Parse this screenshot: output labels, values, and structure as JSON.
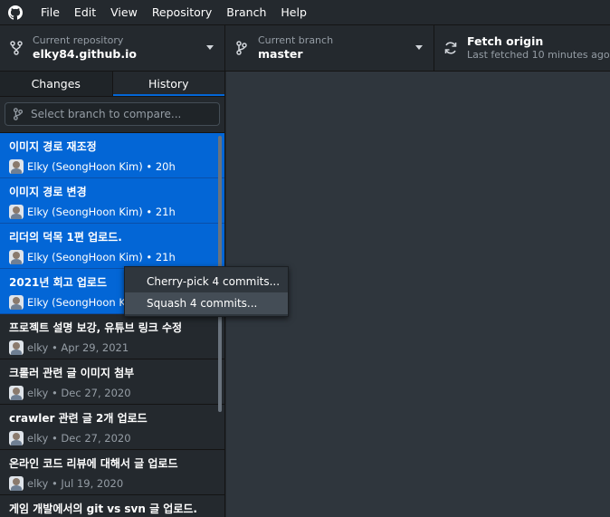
{
  "menubar": {
    "items": [
      "File",
      "Edit",
      "View",
      "Repository",
      "Branch",
      "Help"
    ]
  },
  "toolbar": {
    "repo_label": "Current repository",
    "repo_value": "elky84.github.io",
    "branch_label": "Current branch",
    "branch_value": "master",
    "fetch_title": "Fetch origin",
    "fetch_sub": "Last fetched 10 minutes ago"
  },
  "tabs": {
    "changes": "Changes",
    "history": "History"
  },
  "compare": {
    "placeholder": "Select branch to compare..."
  },
  "commits": [
    {
      "title": "이미지 경로 재조정",
      "meta": "Elky (SeongHoon Kim) • 20h",
      "selected": true
    },
    {
      "title": "이미지 경로 변경",
      "meta": "Elky (SeongHoon Kim) • 21h",
      "selected": true
    },
    {
      "title": "리더의 덕목 1편 업로드.",
      "meta": "Elky (SeongHoon Kim) • 21h",
      "selected": true
    },
    {
      "title": "2021년 회고 업로드",
      "meta": "Elky (SeongHoon Kim",
      "selected": true
    },
    {
      "title": "프로젝트 설명 보강, 유튜브 링크 수정",
      "meta": "elky • Apr 29, 2021",
      "selected": false
    },
    {
      "title": "크롤러 관련 글 이미지 첨부",
      "meta": "elky • Dec 27, 2020",
      "selected": false
    },
    {
      "title": "crawler 관련 글 2개 업로드",
      "meta": "elky • Dec 27, 2020",
      "selected": false
    },
    {
      "title": "온라인 코드 리뷰에 대해서 글 업로드",
      "meta": "elky • Jul 19, 2020",
      "selected": false
    },
    {
      "title": "게임 개발에서의 git vs svn 글 업로드.",
      "meta": "",
      "selected": false
    }
  ],
  "context_menu": {
    "items": [
      "Cherry-pick 4 commits...",
      "Squash 4 commits..."
    ]
  },
  "colors": {
    "accent": "#0366d6",
    "background": "#24292e",
    "main_panel": "#2f363d"
  }
}
